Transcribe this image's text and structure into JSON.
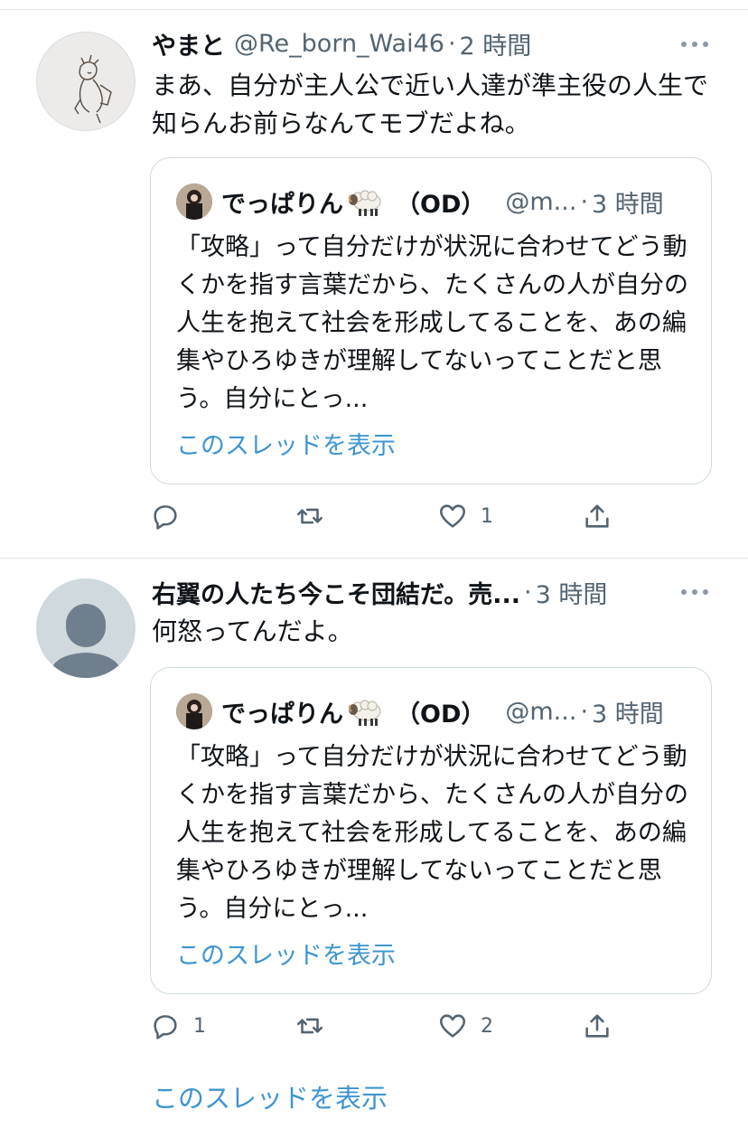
{
  "tweets": [
    {
      "name": "やまと",
      "handle": "@Re_born_Wai46",
      "separator": "·",
      "time": "2 時間",
      "text": "まあ、自分が主人公で近い人達が準主役の人生で知らんお前らなんてモブだよね。",
      "quote": {
        "name": "でっぱりん",
        "od": "（OD）",
        "handle": "@m...",
        "separator": "·",
        "time": "3 時間",
        "text": "「攻略」って自分だけが状況に合わせてどう動くかを指す言葉だから、たくさんの人が自分の人生を抱えて社会を形成してることを、あの編集やひろゆきが理解してないってことだと思う。自分にとっ...",
        "show_thread": "このスレッドを表示"
      },
      "actions": {
        "reply_count": "",
        "retweet_count": "",
        "like_count": "1"
      }
    },
    {
      "name": "右翼の人たち今こそ団結だ。売...",
      "handle": "",
      "separator": "·",
      "time": "3 時間",
      "text": "何怒ってんだよ。",
      "quote": {
        "name": "でっぱりん",
        "od": "（OD）",
        "handle": "@m...",
        "separator": "·",
        "time": "3 時間",
        "text": "「攻略」って自分だけが状況に合わせてどう動くかを指す言葉だから、たくさんの人が自分の人生を抱えて社会を形成してることを、あの編集やひろゆきが理解してないってことだと思う。自分にとっ...",
        "show_thread": "このスレッドを表示"
      },
      "actions": {
        "reply_count": "1",
        "retweet_count": "",
        "like_count": "2"
      }
    }
  ],
  "show_thread": "このスレッドを表示",
  "icons": {
    "reply": "reply-icon",
    "retweet": "retweet-icon",
    "like": "heart-icon",
    "share": "share-icon",
    "more": "more-icon"
  },
  "colors": {
    "link": "#3e95d0",
    "secondary_text": "#536471",
    "border": "#cfd9de"
  }
}
